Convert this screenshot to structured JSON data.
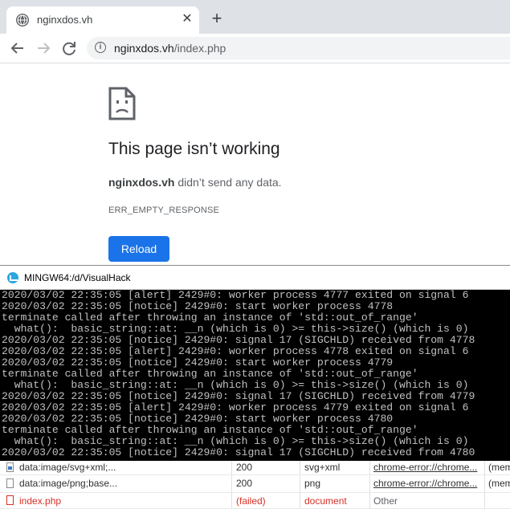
{
  "browser": {
    "tab": {
      "title": "nginxdos.vh",
      "close_glyph": "✕"
    },
    "new_tab_glyph": "+",
    "url": {
      "host": "nginxdos.vh",
      "path": "/index.php"
    }
  },
  "error_page": {
    "title": "This page isn’t working",
    "host_bold": "nginxdos.vh",
    "message": " didn’t send any data.",
    "code": "ERR_EMPTY_RESPONSE",
    "reload_label": "Reload"
  },
  "terminal": {
    "title": "MINGW64:/d/VisualHack",
    "lines": [
      "2020/03/02 22:35:05 [alert] 2429#0: worker process 4777 exited on signal 6",
      "2020/03/02 22:35:05 [notice] 2429#0: start worker process 4778",
      "terminate called after throwing an instance of 'std::out_of_range'",
      "  what():  basic_string::at: __n (which is 0) >= this->size() (which is 0)",
      "2020/03/02 22:35:05 [notice] 2429#0: signal 17 (SIGCHLD) received from 4778",
      "2020/03/02 22:35:05 [alert] 2429#0: worker process 4778 exited on signal 6",
      "2020/03/02 22:35:05 [notice] 2429#0: start worker process 4779",
      "terminate called after throwing an instance of 'std::out_of_range'",
      "  what():  basic_string::at: __n (which is 0) >= this->size() (which is 0)",
      "2020/03/02 22:35:05 [notice] 2429#0: signal 17 (SIGCHLD) received from 4779",
      "2020/03/02 22:35:05 [alert] 2429#0: worker process 4779 exited on signal 6",
      "2020/03/02 22:35:05 [notice] 2429#0: start worker process 4780",
      "terminate called after throwing an instance of 'std::out_of_range'",
      "  what():  basic_string::at: __n (which is 0) >= this->size() (which is 0)",
      "2020/03/02 22:35:05 [notice] 2429#0: signal 17 (SIGCHLD) received from 4780"
    ]
  },
  "network": {
    "rows": [
      {
        "name": "data:image/svg+xml;...",
        "status": "200",
        "type": "svg+xml",
        "initiator": "chrome-error://chrome...",
        "size": "(mem"
      },
      {
        "name": "data:image/png;base...",
        "status": "200",
        "type": "png",
        "initiator": "chrome-error://chrome...",
        "size": "(mem"
      },
      {
        "name": "index.php",
        "status": "(failed)",
        "type": "document",
        "initiator": "Other",
        "size": ""
      }
    ]
  },
  "colors": {
    "accent": "#1a73e8",
    "failed": "#d93025",
    "terminal_bg": "#000000",
    "terminal_fg": "#c0c0c0"
  }
}
